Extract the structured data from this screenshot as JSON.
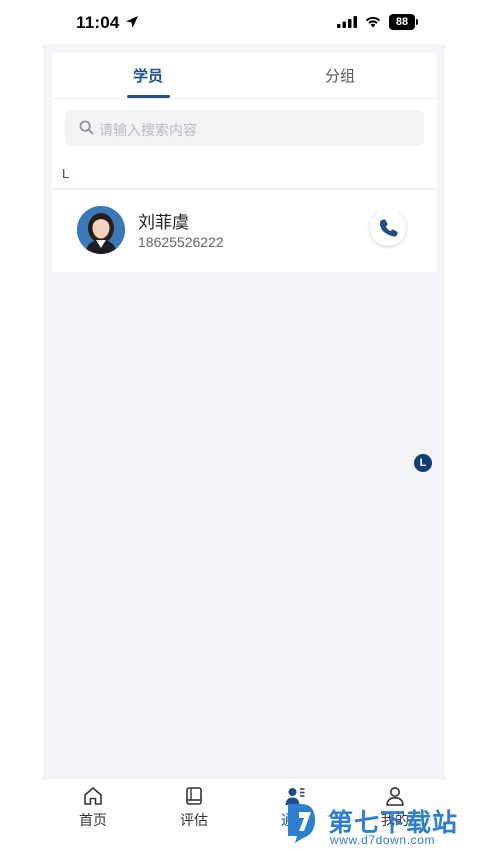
{
  "status_bar": {
    "time": "11:04",
    "battery": "88"
  },
  "tabs": {
    "students": "学员",
    "groups": "分组",
    "active": "students"
  },
  "search": {
    "placeholder": "请输入搜索内容"
  },
  "contacts": {
    "section_letter": "L",
    "items": [
      {
        "name": "刘菲虞",
        "phone": "18625526222"
      }
    ]
  },
  "index_bar": {
    "letters": [
      "L"
    ]
  },
  "bottom_nav": {
    "items": [
      {
        "label": "首页",
        "icon": "home-icon"
      },
      {
        "label": "评估",
        "icon": "book-icon"
      },
      {
        "label": "通讯",
        "icon": "contacts-icon",
        "active": true
      },
      {
        "label": "我的",
        "icon": "user-icon"
      }
    ]
  },
  "watermark": {
    "title": "第七下载站",
    "url": "www.d7down.com"
  },
  "colors": {
    "accent": "#1f4f86",
    "background": "#f3f5f8",
    "badge": "#0f3f73",
    "watermark": "#2d7fd0"
  }
}
